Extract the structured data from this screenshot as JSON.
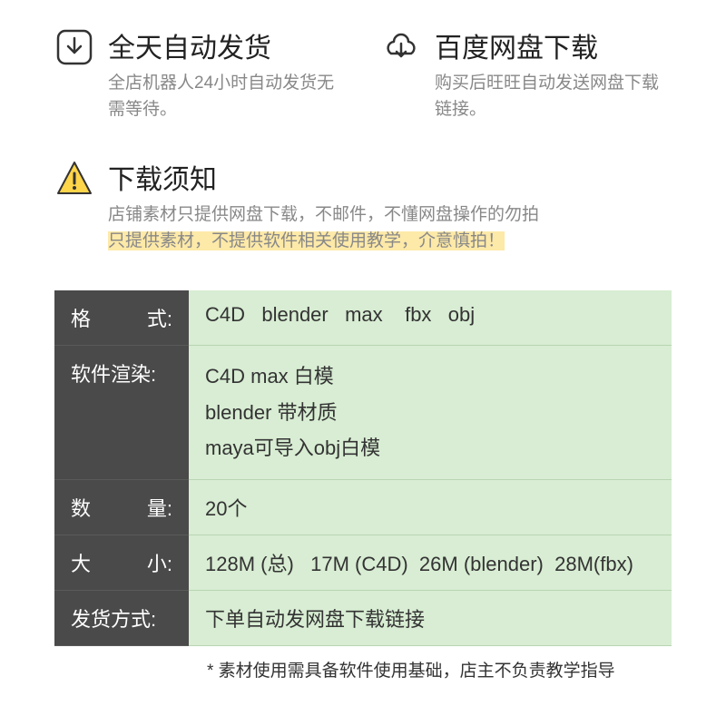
{
  "features": {
    "autoship": {
      "title": "全天自动发货",
      "desc": "全店机器人24小时自动发货无需等待。"
    },
    "baidu": {
      "title": "百度网盘下载",
      "desc": "购买后旺旺自动发送网盘下载链接。"
    }
  },
  "notice": {
    "title": "下载须知",
    "line1": "店铺素材只提供网盘下载，不邮件，不懂网盘操作的勿拍",
    "line2": "只提供素材，不提供软件相关使用教学，介意慎拍！"
  },
  "spec": {
    "format_label_a": "格",
    "format_label_b": "式:",
    "format_value": "C4D   blender   max    fbx   obj",
    "render_label": "软件渲染:",
    "render_line1": "C4D  max 白模",
    "render_line2": "blender 带材质",
    "render_line3": "maya可导入obj白模",
    "count_label_a": "数",
    "count_label_b": "量:",
    "count_value": "20个",
    "size_label_a": "大",
    "size_label_b": "小:",
    "size_value": "128M (总)   17M (C4D)  26M (blender)  28M(fbx)",
    "delivery_label": "发货方式:",
    "delivery_value": "下单自动发网盘下载链接"
  },
  "footnote": "* 素材使用需具备软件使用基础，店主不负责教学指导"
}
